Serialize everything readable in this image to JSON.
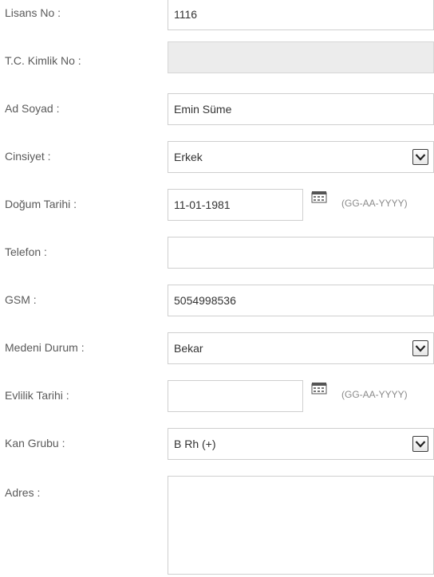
{
  "form": {
    "lisans_no": {
      "label": "Lisans No :",
      "value": "1116"
    },
    "tc_kimlik_no": {
      "label": "T.C. Kimlik No :",
      "value": ""
    },
    "ad_soyad": {
      "label": "Ad Soyad :",
      "value": "Emin Süme"
    },
    "cinsiyet": {
      "label": "Cinsiyet :",
      "value": "Erkek"
    },
    "dogum_tarihi": {
      "label": "Doğum Tarihi :",
      "value": "11-01-1981",
      "format": "(GG-AA-YYYY)"
    },
    "telefon": {
      "label": "Telefon :",
      "value": ""
    },
    "gsm": {
      "label": "GSM :",
      "value": "5054998536"
    },
    "medeni_durum": {
      "label": "Medeni Durum :",
      "value": "Bekar"
    },
    "evlilik_tarihi": {
      "label": "Evlilik Tarihi :",
      "value": "",
      "format": "(GG-AA-YYYY)"
    },
    "kan_grubu": {
      "label": "Kan Grubu :",
      "value": "B Rh (+)"
    },
    "adres": {
      "label": "Adres :",
      "value": ""
    }
  },
  "icons": {
    "calendar": "calendar-icon",
    "dropdown": "chevron-down-icon"
  },
  "colors": {
    "label_text": "#5a5a5a",
    "field_border": "#cfcfcf",
    "disabled_bg": "#ececec",
    "hint_text": "#8a8a8a"
  }
}
